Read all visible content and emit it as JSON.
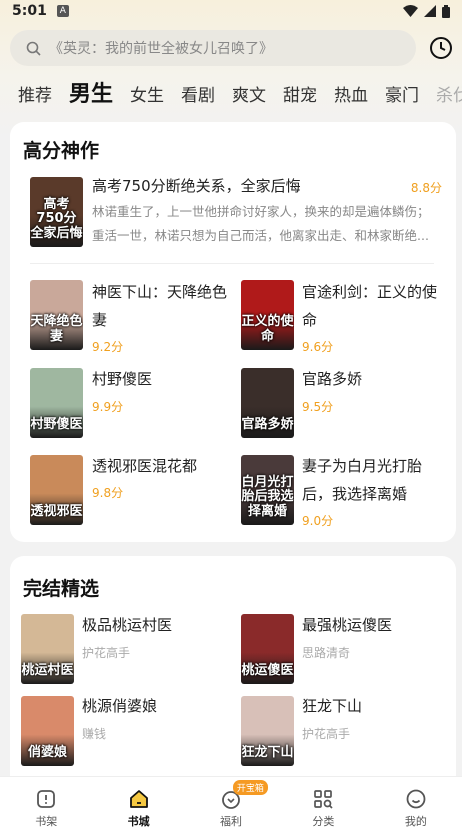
{
  "status": {
    "time": "5:01",
    "notif_icon": "A"
  },
  "search": {
    "placeholder": "《英灵：我的前世全被女儿召唤了》"
  },
  "tabs": [
    "推荐",
    "男生",
    "女生",
    "看剧",
    "爽文",
    "甜宠",
    "热血",
    "豪门",
    "杀伐果"
  ],
  "active_tab": "男生",
  "section1": {
    "title": "高分神作",
    "featured": {
      "title": "高考750分断绝关系，全家后悔",
      "score": "8.8分",
      "desc1": "林诺重生了，上一世他拼命讨好家人，换来的却是遍体鳞伤；",
      "desc2": "重活一世，林诺只想为自己而活，他离家出走、和林家断绝...",
      "cover_text": "高考750分全家后悔",
      "cover_color": "#5a3a2a"
    },
    "books": [
      {
        "title1": "神医下山：天降绝色",
        "title2": "妻",
        "score": "9.2分",
        "cover_text": "天降绝色妻",
        "cover_color": "#c9a89a"
      },
      {
        "title1": "官途利剑：正义的使",
        "title2": "命",
        "score": "9.6分",
        "cover_text": "正义的使命",
        "cover_color": "#b01a1a"
      },
      {
        "title1": "村野傻医",
        "title2": "",
        "score": "9.9分",
        "cover_text": "村野傻医",
        "cover_color": "#9fb7a0"
      },
      {
        "title1": "官路多娇",
        "title2": "",
        "score": "9.5分",
        "cover_text": "官路多娇",
        "cover_color": "#3a2e2a"
      },
      {
        "title1": "透视邪医混花都",
        "title2": "",
        "score": "9.8分",
        "cover_text": "透视邪医",
        "cover_color": "#c98a5a"
      },
      {
        "title1": "妻子为白月光打胎",
        "title2": "后，我选择离婚",
        "score": "9.0分",
        "cover_text": "白月光打胎后我选择离婚",
        "cover_color": "#4a3a3a"
      }
    ]
  },
  "section2": {
    "title": "完结精选",
    "books": [
      {
        "title": "极品桃运村医",
        "author": "护花高手",
        "cover_text": "桃运村医",
        "cover_color": "#d4b896"
      },
      {
        "title": "最强桃运傻医",
        "author": "思路清奇",
        "cover_text": "桃运傻医",
        "cover_color": "#8a2a2a"
      },
      {
        "title": "桃源俏婆娘",
        "author": "赚钱",
        "cover_text": "俏婆娘",
        "cover_color": "#d98a6a"
      },
      {
        "title": "狂龙下山",
        "author": "护花高手",
        "cover_text": "狂龙下山",
        "cover_color": "#d8c0b8"
      }
    ]
  },
  "nav": {
    "items": [
      "书架",
      "书城",
      "福利",
      "分类",
      "我的"
    ],
    "active": "书城",
    "badge": "开宝箱"
  },
  "colors": {
    "accent_score": "#f0a020",
    "badge": "#f59a23"
  }
}
